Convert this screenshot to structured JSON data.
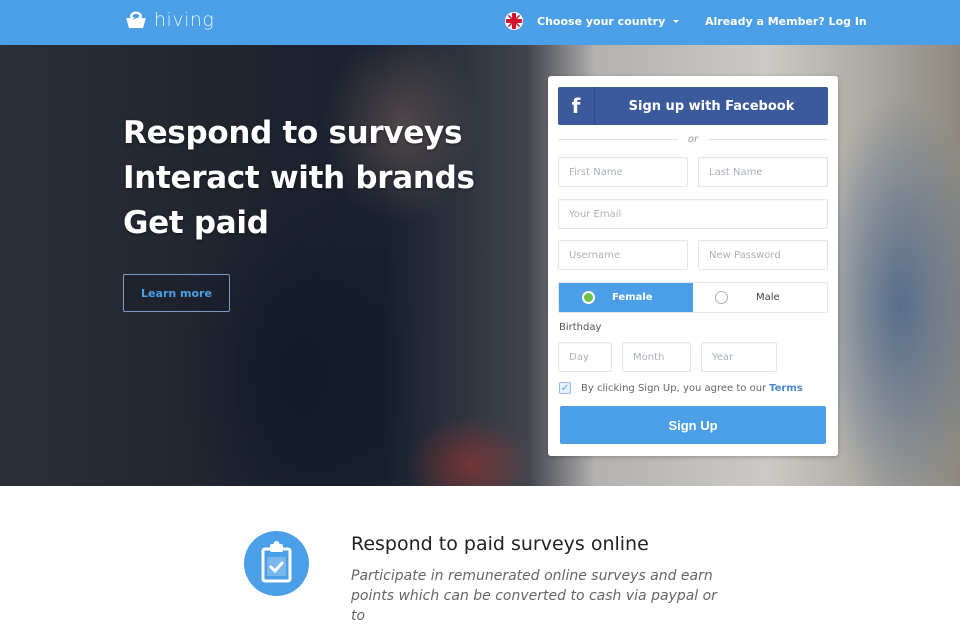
{
  "header": {
    "logo_text": "hiving",
    "country_selector": "Choose your country",
    "login_link": "Already a Member? Log In",
    "accent_color": "#4a9fe6"
  },
  "hero": {
    "headline_lines": [
      "Respond to surveys",
      "Interact with brands",
      "Get paid"
    ],
    "learn_more_label": "Learn more"
  },
  "signup": {
    "facebook_label": "Sign up with Facebook",
    "facebook_icon": "f",
    "divider_text": "or",
    "first_name_placeholder": "First Name",
    "last_name_placeholder": "Last Name",
    "email_placeholder": "Your Email",
    "username_placeholder": "Username",
    "password_placeholder": "New Password",
    "gender_options": [
      {
        "label": "Female",
        "selected": true
      },
      {
        "label": "Male",
        "selected": false
      }
    ],
    "birthday_label": "Birthday",
    "day_placeholder": "Day",
    "month_placeholder": "Month",
    "year_placeholder": "Year",
    "terms_checked": true,
    "terms_text": "By clicking Sign Up, you agree to our",
    "terms_link": "Terms",
    "signup_label": "Sign Up",
    "facebook_color": "#3b5a9b"
  },
  "features": {
    "title": "Respond to paid surveys online",
    "description": "Participate in remunerated online surveys and earn points which can be converted to cash via paypal or to"
  }
}
